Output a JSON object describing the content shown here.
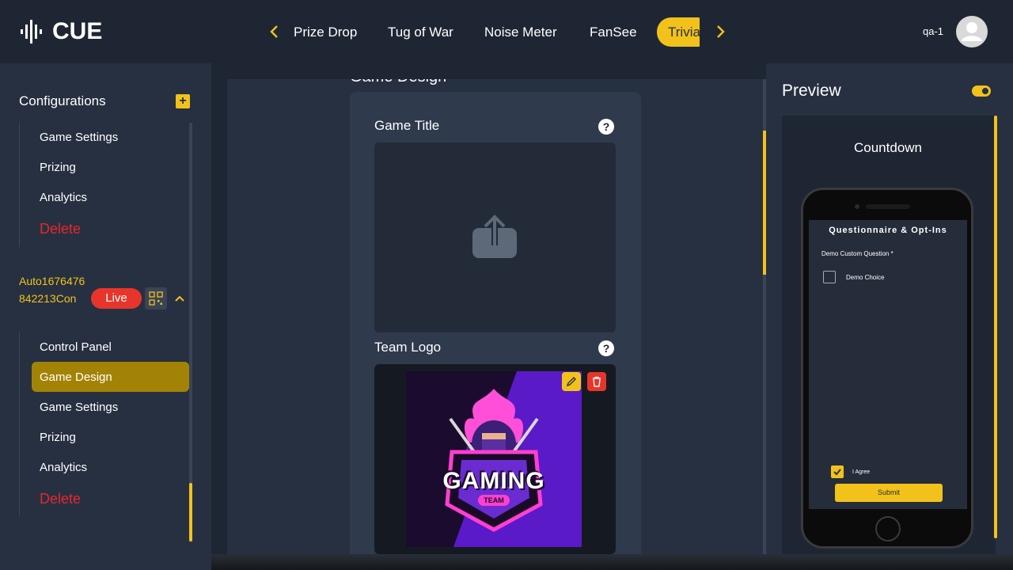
{
  "header": {
    "logo_text": "CUE",
    "tabs": [
      {
        "label": "Prize Drop"
      },
      {
        "label": "Tug of War"
      },
      {
        "label": "Noise Meter"
      },
      {
        "label": "FanSee"
      },
      {
        "label": "Trivia",
        "active": true
      }
    ],
    "user_name": "qa-1"
  },
  "sidebar": {
    "title": "Configurations",
    "group1": [
      {
        "label": "Game Settings"
      },
      {
        "label": "Prizing"
      },
      {
        "label": "Analytics"
      },
      {
        "label": "Delete"
      }
    ],
    "game_name": "Auto1676476842213Con",
    "live_label": "Live",
    "group2": [
      {
        "label": "Control Panel"
      },
      {
        "label": "Game Design",
        "active": true
      },
      {
        "label": "Game Settings"
      },
      {
        "label": "Prizing"
      },
      {
        "label": "Analytics"
      },
      {
        "label": "Delete"
      }
    ]
  },
  "main": {
    "section_title": "Game Design",
    "game_title_label": "Game Title",
    "team_logo_label": "Team Logo",
    "logo_text_1": "GAMING",
    "logo_text_2": "TEAM"
  },
  "preview": {
    "title": "Preview",
    "countdown": "Countdown",
    "q_title": "Questionnaire & Opt-Ins",
    "question_label": "Demo Custom Question *",
    "choice_label": "Demo Choice",
    "agree_label": "I Agree",
    "submit_label": "Submit"
  },
  "colors": {
    "accent": "#f2c21b",
    "danger": "#e8262b",
    "bg": "#1f2633",
    "panel": "#273041"
  }
}
